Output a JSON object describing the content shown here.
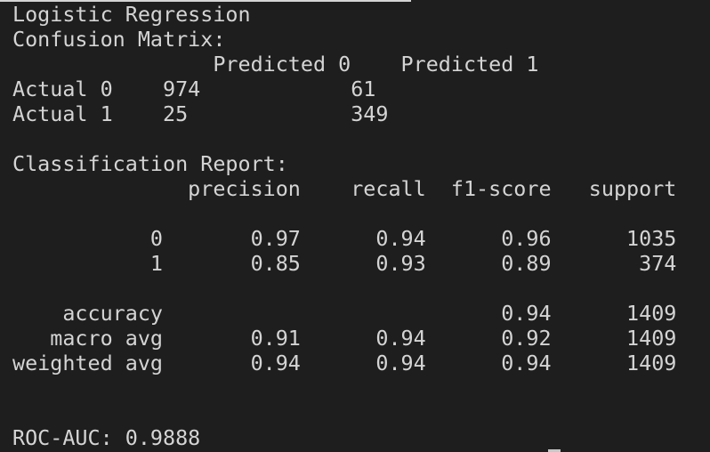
{
  "terminal": {
    "top_cutoff": "             '",
    "lines": [
      "Logistic Regression",
      "Confusion Matrix:",
      "                Predicted 0    Predicted 1",
      "Actual 0    974            61",
      "Actual 1    25             349",
      "",
      "Classification Report:",
      "              precision    recall  f1-score   support",
      "",
      "           0       0.97      0.94      0.96      1035",
      "           1       0.85      0.93      0.89       374",
      "",
      "    accuracy                           0.94      1409",
      "   macro avg       0.91      0.94      0.92      1409",
      "weighted avg       0.94      0.94      0.94      1409",
      "",
      "",
      "ROC-AUC: 0.9888"
    ]
  }
}
